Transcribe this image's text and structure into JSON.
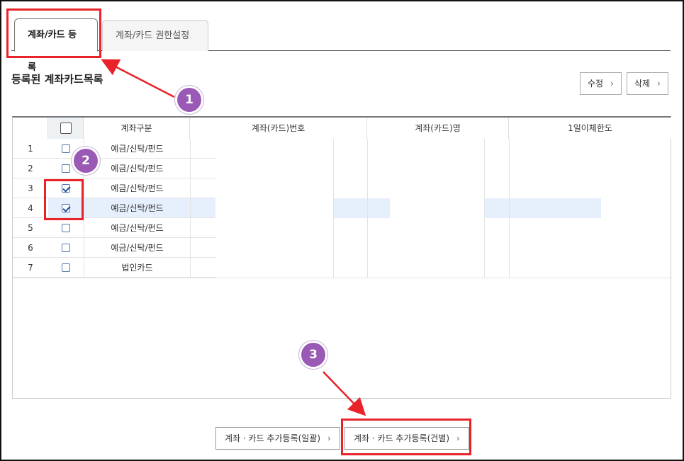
{
  "tabs": [
    {
      "label": "계좌/카드 등록",
      "active": true
    },
    {
      "label": "계좌/카드 권한설정",
      "active": false
    }
  ],
  "section_title": "등록된 계좌카드목록",
  "buttons": {
    "edit": "수정",
    "delete": "삭제"
  },
  "table": {
    "columns": [
      "계좌구분",
      "계좌(카드)번호",
      "계좌(카드)명",
      "1일이체한도"
    ],
    "rows": [
      {
        "no": "1",
        "type": "예금/신탁/펀드",
        "checked": false
      },
      {
        "no": "2",
        "type": "예금/신탁/펀드",
        "checked": false
      },
      {
        "no": "3",
        "type": "예금/신탁/펀드",
        "checked": true
      },
      {
        "no": "4",
        "type": "예금/신탁/펀드",
        "checked": true,
        "highlighted": true
      },
      {
        "no": "5",
        "type": "예금/신탁/펀드",
        "checked": false
      },
      {
        "no": "6",
        "type": "예금/신탁/펀드",
        "checked": false
      },
      {
        "no": "7",
        "type": "법인카드",
        "checked": false
      }
    ]
  },
  "bottom_buttons": {
    "bulk": "계좌 · 카드 추가등록(일괄)",
    "single": "계좌 · 카드 추가등록(건별)"
  },
  "annotations": {
    "one": "1",
    "two": "2",
    "three": "3"
  },
  "colors": {
    "highlight": "#e6f0fd",
    "annotation_red": "#e8232a",
    "badge_purple": "#9b59b6"
  },
  "icons": {
    "chevron": "chevron-right-icon"
  }
}
